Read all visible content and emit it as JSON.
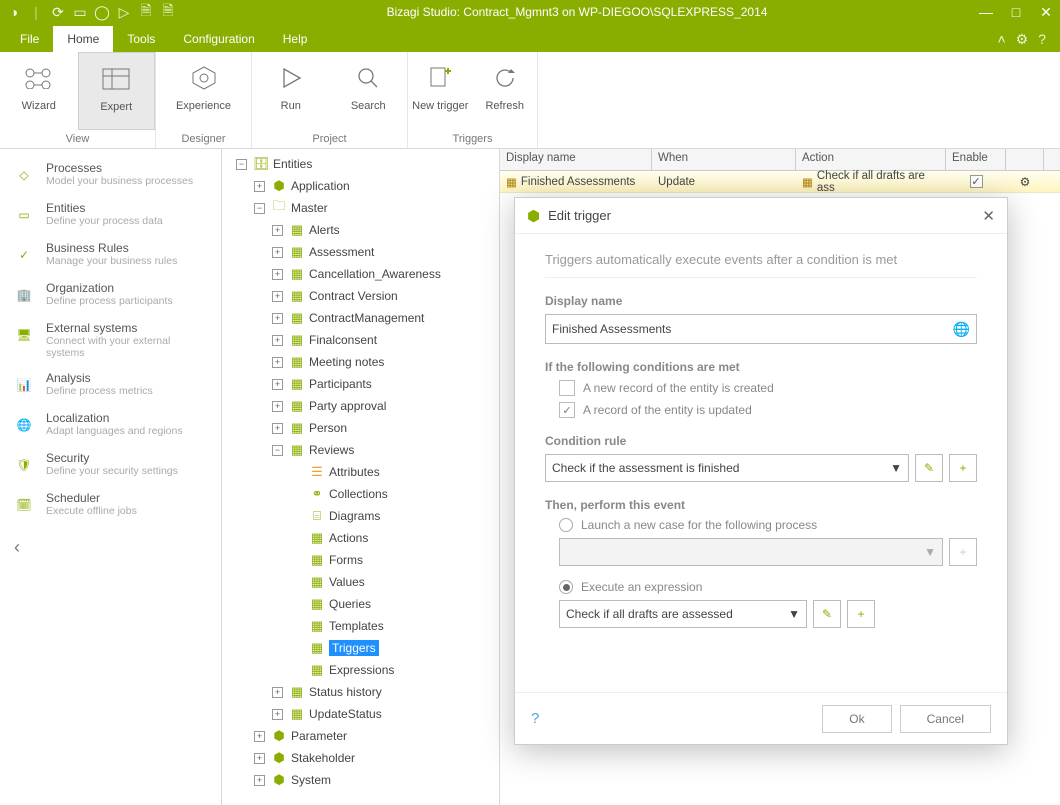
{
  "title": "Bizagi Studio: Contract_Mgmnt3  on WP-DIEGOO\\SQLEXPRESS_2014",
  "tabs": {
    "file": "File",
    "home": "Home",
    "tools": "Tools",
    "configuration": "Configuration",
    "help": "Help"
  },
  "ribbon": {
    "wizard": "Wizard",
    "expert": "Expert",
    "experience": "Experience",
    "run": "Run",
    "search": "Search",
    "newtrigger": "New trigger",
    "refresh": "Refresh",
    "g_view": "View",
    "g_designer": "Designer",
    "g_project": "Project",
    "g_triggers": "Triggers"
  },
  "left": {
    "processes": {
      "t": "Processes",
      "d": "Model your business processes"
    },
    "entities": {
      "t": "Entities",
      "d": "Define your process data"
    },
    "rules": {
      "t": "Business Rules",
      "d": "Manage your business rules"
    },
    "org": {
      "t": "Organization",
      "d": "Define process participants"
    },
    "ext": {
      "t": "External systems",
      "d": "Connect with your external systems"
    },
    "analysis": {
      "t": "Analysis",
      "d": "Define process metrics"
    },
    "local": {
      "t": "Localization",
      "d": "Adapt languages and regions"
    },
    "security": {
      "t": "Security",
      "d": "Define your security settings"
    },
    "scheduler": {
      "t": "Scheduler",
      "d": "Execute offline jobs"
    }
  },
  "tree": {
    "root": "Entities",
    "application": "Application",
    "master": "Master",
    "alerts": "Alerts",
    "assessment": "Assessment",
    "canc": "Cancellation_Awareness",
    "cv": "Contract Version",
    "cm": "ContractManagement",
    "fc": "Finalconsent",
    "mn": "Meeting notes",
    "part": "Participants",
    "pa": "Party approval",
    "person": "Person",
    "reviews": "Reviews",
    "attrs": "Attributes",
    "coll": "Collections",
    "diag": "Diagrams",
    "actions": "Actions",
    "forms": "Forms",
    "values": "Values",
    "queries": "Queries",
    "templates": "Templates",
    "triggers": "Triggers",
    "expr": "Expressions",
    "sh": "Status history",
    "us": "UpdateStatus",
    "param": "Parameter",
    "stake": "Stakeholder",
    "system": "System"
  },
  "grid": {
    "h_disp": "Display name",
    "h_when": "When",
    "h_action": "Action",
    "h_enable": "Enable",
    "r_disp": "Finished Assessments",
    "r_when": "Update",
    "r_action": "Check if all drafts are ass"
  },
  "modal": {
    "title": "Edit trigger",
    "desc": "Triggers automatically execute events after a condition is met",
    "display_name_label": "Display name",
    "display_name_value": "Finished Assessments",
    "cond_head": "If the following conditions are met",
    "cond_create": "A new record of the entity is created",
    "cond_update": "A record of the entity is updated",
    "cond_rule_label": "Condition rule",
    "cond_rule_value": "Check if the assessment is finished",
    "then_label": "Then, perform this event",
    "opt_launch": "Launch a new case for the following process",
    "opt_expr": "Execute an expression",
    "expr_value": "Check if all drafts are assessed",
    "ok": "Ok",
    "cancel": "Cancel"
  }
}
